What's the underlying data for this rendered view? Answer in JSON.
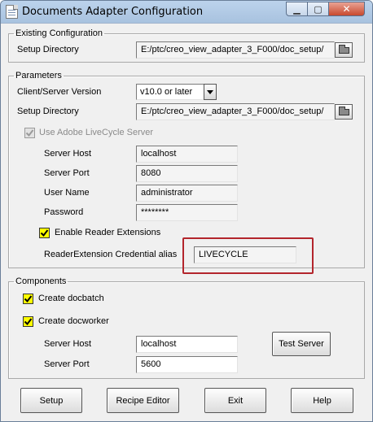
{
  "window": {
    "title": "Documents Adapter Configuration",
    "controls": {
      "minimize": "▁",
      "maximize": "▢",
      "close": "✕"
    }
  },
  "existing": {
    "legend": "Existing Configuration",
    "setup_dir_label": "Setup Directory",
    "setup_dir_value": "E:/ptc/creo_view_adapter_3_F000/doc_setup/"
  },
  "params": {
    "legend": "Parameters",
    "version_label": "Client/Server Version",
    "version_value": "v10.0 or later",
    "setup_dir_label": "Setup Directory",
    "setup_dir_value": "E:/ptc/creo_view_adapter_3_F000/doc_setup/",
    "use_livecycle_label": "Use Adobe LiveCycle Server",
    "use_livecycle_checked": true,
    "server_host_label": "Server Host",
    "server_host_value": "localhost",
    "server_port_label": "Server Port",
    "server_port_value": "8080",
    "user_name_label": "User Name",
    "user_name_value": "administrator",
    "password_label": "Password",
    "password_value": "********",
    "enable_reader_label": "Enable Reader Extensions",
    "enable_reader_checked": true,
    "credential_label": "ReaderExtension Credential alias",
    "credential_value": "LIVECYCLE"
  },
  "components": {
    "legend": "Components",
    "docbatch_label": "Create docbatch",
    "docbatch_checked": true,
    "docworker_label": "Create docworker",
    "docworker_checked": true,
    "server_host_label": "Server Host",
    "server_host_value": "localhost",
    "server_port_label": "Server Port",
    "server_port_value": "5600",
    "test_server_label": "Test Server"
  },
  "buttons": {
    "setup": "Setup",
    "recipe_editor": "Recipe Editor",
    "exit": "Exit",
    "help": "Help"
  },
  "colors": {
    "checkbox_fill": "#ffff00",
    "highlight_border": "#b3252c"
  }
}
